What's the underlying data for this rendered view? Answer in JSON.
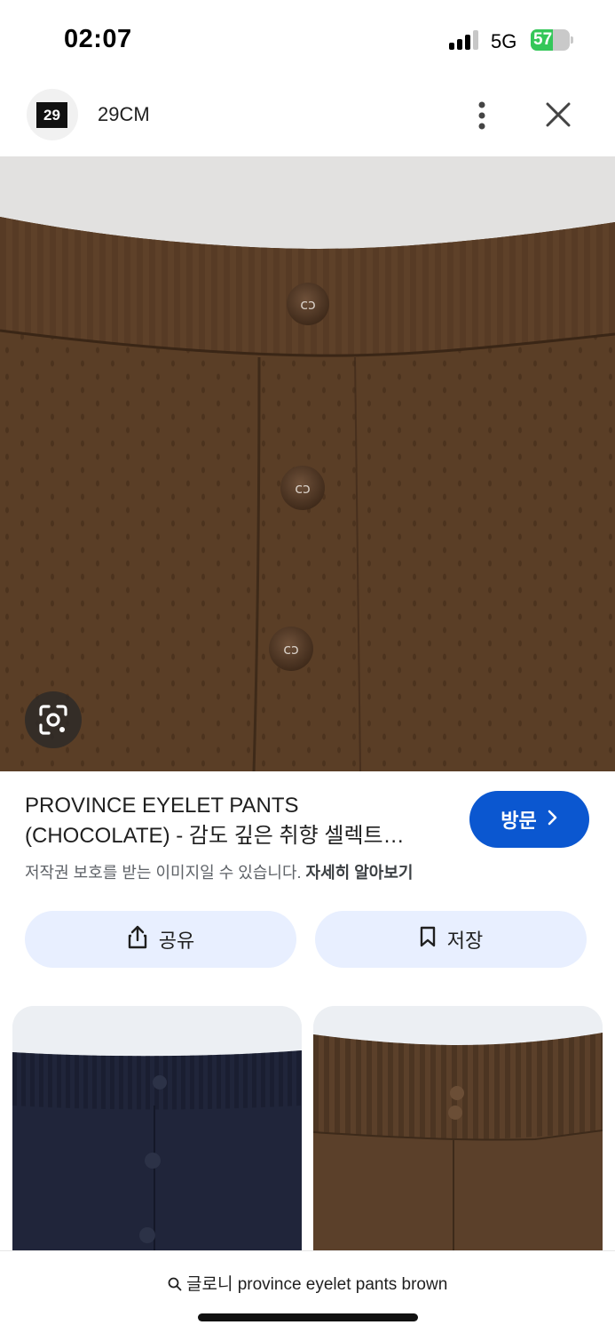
{
  "status_bar": {
    "time": "02:07",
    "network": "5G",
    "battery_level": "57",
    "battery_percent": 57,
    "battery_color": "#34c759"
  },
  "header": {
    "app_name": "29CM",
    "logo_text": "29",
    "more_icon": "more-vertical-icon",
    "close_icon": "close-icon"
  },
  "hero_image": {
    "lens_icon": "google-lens-icon",
    "colors": {
      "fabric": "#5a3e26",
      "background": "#e2e1e0"
    }
  },
  "result": {
    "title_line1": "PROVINCE EYELET PANTS",
    "title_line2": "(CHOCOLATE) - 감도 깊은 취향 셀렉트…",
    "visit_label": "방문",
    "visit_icon": "chevron-right-icon",
    "copyright_text": "저작권 보호를 받는 이미지일 수 있습니다. ",
    "learn_more": "자세히 알아보기",
    "accent_color": "#0b57d0"
  },
  "actions": {
    "share_label": "공유",
    "share_icon": "share-icon",
    "save_label": "저장",
    "save_icon": "bookmark-icon"
  },
  "related": [
    {
      "color": "#20253a"
    },
    {
      "color": "#5b402a"
    }
  ],
  "search": {
    "query": "글로니 province eyelet pants brown",
    "icon": "search-icon"
  }
}
